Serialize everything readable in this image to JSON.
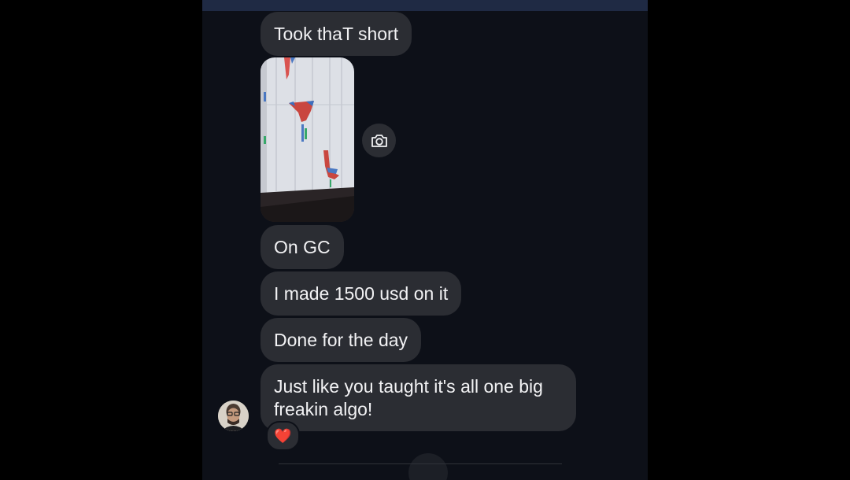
{
  "conversation": {
    "messages": [
      {
        "text": "Took thaT short"
      },
      {
        "text": "On GC"
      },
      {
        "text": "I made 1500 usd on it"
      },
      {
        "text": "Done for the day"
      },
      {
        "text": "Just like you taught it's all one big freakin algo!"
      }
    ],
    "photo_icon": "camera-icon",
    "reaction": "❤️"
  },
  "colors": {
    "background": "#0d1018",
    "bubble": "#2b2d33",
    "text": "#f2f2f4",
    "top_bar": "#1f2a44"
  }
}
